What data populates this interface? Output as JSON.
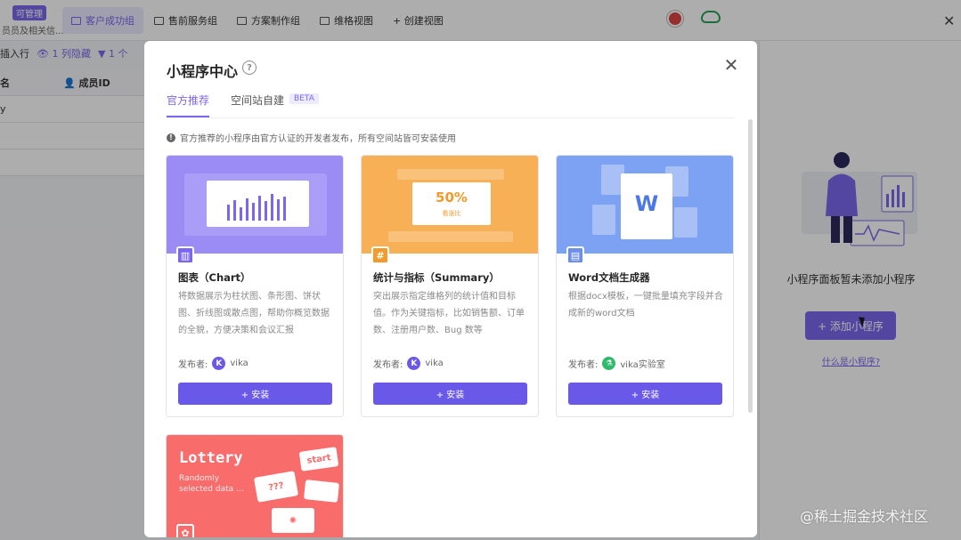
{
  "background": {
    "role_tag": "可管理",
    "role_sub": "员员及相关信...",
    "views": [
      {
        "label": "客户成功组",
        "active": true
      },
      {
        "label": "售前服务组",
        "active": false
      },
      {
        "label": "方案制作组",
        "active": false
      },
      {
        "label": "维格视图",
        "active": false
      }
    ],
    "create_view": "+ 创建视图",
    "toolbar": {
      "insert_row": "插入行",
      "hidden_cols": "1 列隐藏",
      "filter": "1 个"
    },
    "grid": {
      "col_name": "名",
      "col_member": "成员ID",
      "row1": "y"
    },
    "panel": {
      "empty_text": "小程序面板暂未添加小程序",
      "add_button": "+ 添加小程序",
      "what_is": "什么是小程序?"
    }
  },
  "modal": {
    "title": "小程序中心",
    "tabs": [
      {
        "label": "官方推荐",
        "active": true
      },
      {
        "label": "空间站自建",
        "active": false,
        "badge": "BETA"
      }
    ],
    "notice": "官方推荐的小程序由官方认证的开发者发布，所有空间站皆可安装使用",
    "publisher_label": "发布者:",
    "install_label": "+ 安装",
    "cards": [
      {
        "name": "图表（Chart）",
        "description": "将数据展示为柱状图、条形图、饼状图、折线图或散点图，帮助你概览数据的全貌，方便决策和会议汇报",
        "publisher": "vika",
        "banner_color": "#9b8cf5"
      },
      {
        "name": "统计与指标（Summary）",
        "description": "突出展示指定维格列的统计值和目标值。作为关键指标，比如销售额、订单数、注册用户数、Bug 数等",
        "publisher": "vika",
        "banner_color": "#f8b056",
        "banner_value": "50%",
        "banner_caption": "看涨比"
      },
      {
        "name": "Word文档生成器",
        "description": "根据docx模板，一键批量填充字段并合成新的word文档",
        "publisher": "vika实验室",
        "banner_color": "#7ea2f3",
        "banner_letter": "W"
      }
    ],
    "lottery": {
      "title": "Lottery",
      "subtitle": "Randomly selected data ...",
      "ticket_start": "start",
      "ticket_q": "???"
    }
  },
  "watermark": "@稀土掘金技术社区",
  "colors": {
    "accent": "#7b67ee",
    "install": "#6a58e8"
  }
}
